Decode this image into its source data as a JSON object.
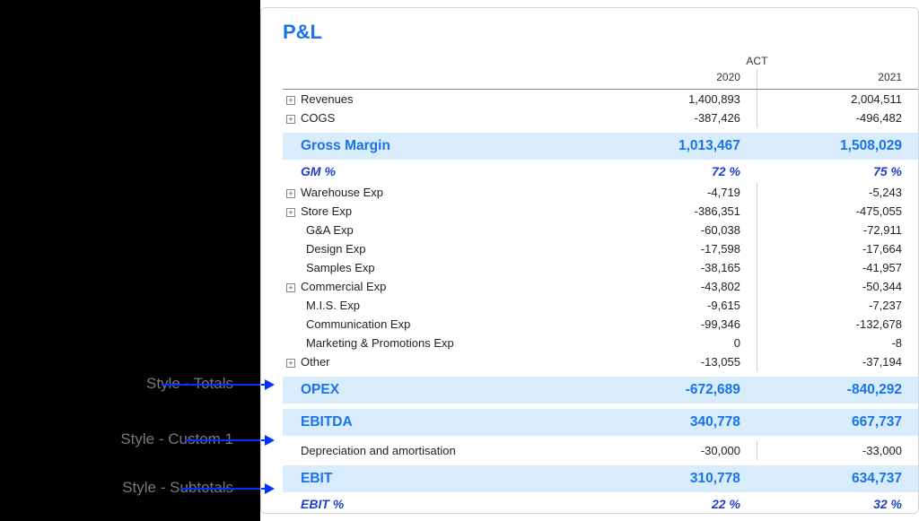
{
  "annotations": {
    "totals": "Style - Totals",
    "custom1": "Style - Custom 1",
    "subtotals": "Style - Subtotals"
  },
  "report": {
    "title": "P&L",
    "periodHeader": "ACT",
    "years": [
      "2020",
      "2021"
    ],
    "rows": [
      {
        "style": "normal",
        "expandable": true,
        "label": "Revenues",
        "values": [
          "1,400,893",
          "2,004,511"
        ]
      },
      {
        "style": "normal",
        "expandable": true,
        "label": "COGS",
        "values": [
          "-387,426",
          "-496,482"
        ]
      },
      {
        "style": "totals",
        "label": "Gross Margin",
        "values": [
          "1,013,467",
          "1,508,029"
        ]
      },
      {
        "style": "subtotals",
        "label": "GM %",
        "values": [
          "72 %",
          "75 %"
        ]
      },
      {
        "style": "normal",
        "expandable": true,
        "label": "Warehouse Exp",
        "values": [
          "-4,719",
          "-5,243"
        ]
      },
      {
        "style": "normal",
        "expandable": true,
        "label": "Store Exp",
        "values": [
          "-386,351",
          "-475,055"
        ]
      },
      {
        "style": "normal",
        "indent": true,
        "label": "G&A Exp",
        "values": [
          "-60,038",
          "-72,911"
        ]
      },
      {
        "style": "normal",
        "indent": true,
        "label": "Design Exp",
        "values": [
          "-17,598",
          "-17,664"
        ]
      },
      {
        "style": "normal",
        "indent": true,
        "label": "Samples Exp",
        "values": [
          "-38,165",
          "-41,957"
        ]
      },
      {
        "style": "normal",
        "expandable": true,
        "label": "Commercial Exp",
        "values": [
          "-43,802",
          "-50,344"
        ]
      },
      {
        "style": "normal",
        "indent": true,
        "label": "M.I.S. Exp",
        "values": [
          "-9,615",
          "-7,237"
        ]
      },
      {
        "style": "normal",
        "indent": true,
        "label": "Communication Exp",
        "values": [
          "-99,346",
          "-132,678"
        ]
      },
      {
        "style": "normal",
        "indent": true,
        "label": "Marketing & Promotions Exp",
        "values": [
          "0",
          "-8"
        ]
      },
      {
        "style": "normal",
        "expandable": true,
        "label": "Other",
        "values": [
          "-13,055",
          "-37,194"
        ]
      },
      {
        "style": "totals",
        "label": "OPEX",
        "values": [
          "-672,689",
          "-840,292"
        ]
      },
      {
        "style": "totals",
        "label": "EBITDA",
        "values": [
          "340,778",
          "667,737"
        ]
      },
      {
        "style": "custom1",
        "label": "Depreciation and amortisation",
        "values": [
          "-30,000",
          "-33,000"
        ]
      },
      {
        "style": "totals",
        "label": "EBIT",
        "values": [
          "310,778",
          "634,737"
        ]
      },
      {
        "style": "subtotals",
        "label": "EBIT %",
        "values": [
          "22 %",
          "32 %"
        ]
      }
    ]
  }
}
